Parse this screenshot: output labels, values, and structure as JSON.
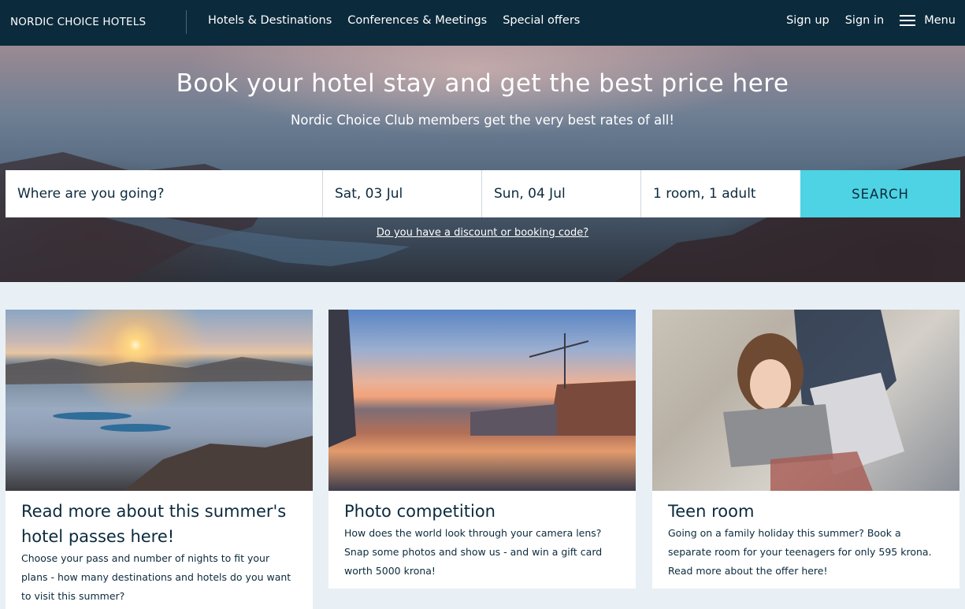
{
  "header": {
    "logo": "NORDIC CHOICE HOTELS",
    "nav": [
      "Hotels & Destinations",
      "Conferences & Meetings",
      "Special offers"
    ],
    "sign_up": "Sign up",
    "sign_in": "Sign in",
    "menu": "Menu"
  },
  "hero": {
    "title": "Book your hotel stay and get the best price here",
    "subtitle": "Nordic Choice Club members get the very best rates of all!"
  },
  "search": {
    "destination_placeholder": "Where are you going?",
    "check_in": "Sat, 03 Jul",
    "check_out": "Sun, 04 Jul",
    "guests": "1 room, 1 adult",
    "button": "SEARCH",
    "discount_link": "Do you have a discount or booking code?"
  },
  "cards": [
    {
      "title": "Read more about this summer's hotel passes here!",
      "text": "Choose your pass and number of nights to fit your plans - how many destinations and hotels do you want to visit this summer?"
    },
    {
      "title": "Photo competition",
      "text": "How does the world look through your camera lens? Snap some photos and show us - and win a gift card worth 5000 krona!"
    },
    {
      "title": "Teen room",
      "text": "Going on a family holiday this summer? Book a separate room for your teenagers for only 595 krona. Read more about the offer here!"
    }
  ],
  "colors": {
    "nav_bg": "#0b2a3c",
    "search_button": "#4dd3e3",
    "page_bg": "#e8f0f5"
  }
}
